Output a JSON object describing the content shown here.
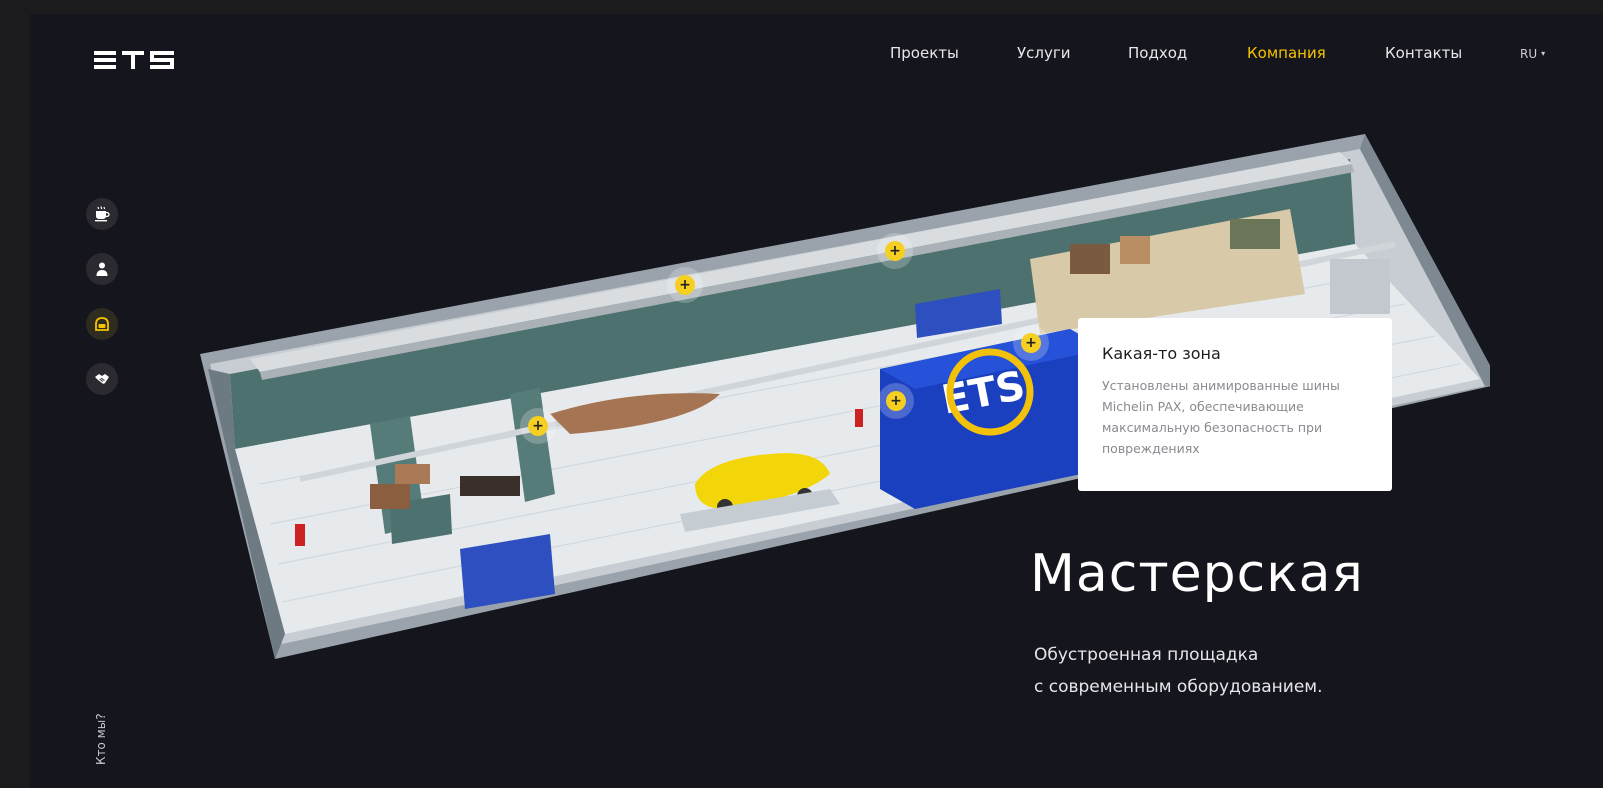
{
  "brand": {
    "logo_text": "ETS"
  },
  "nav": {
    "items": [
      {
        "label": "Проекты",
        "active": false
      },
      {
        "label": "Услуги",
        "active": false
      },
      {
        "label": "Подход",
        "active": false
      },
      {
        "label": "Компания",
        "active": true
      },
      {
        "label": "Контакты",
        "active": false
      }
    ],
    "language": "RU"
  },
  "side_menu": [
    {
      "icon": "coffee-cup-icon",
      "active": false
    },
    {
      "icon": "user-icon",
      "active": false
    },
    {
      "icon": "car-icon",
      "active": true
    },
    {
      "icon": "handshake-icon",
      "active": false
    }
  ],
  "vertical_label": "Кто мы?",
  "tooltip": {
    "title": "Какая-то зона",
    "text_lines": [
      "Установлены анимированные шины",
      "Michelin PAX, обеспечивающие",
      "максимальную безопасность при",
      "повреждениях"
    ]
  },
  "hero": {
    "title": "Мастерская",
    "subtitle_lines": [
      "Обустроенная площадка",
      "с современным оборудованием."
    ]
  },
  "hotspot_symbol": "+",
  "colors": {
    "accent": "#f5c400",
    "background": "#15151d",
    "wall": "#4f7370",
    "floor": "#e7ebee",
    "container": "#1a3fbf",
    "car": "#f2d60a"
  }
}
